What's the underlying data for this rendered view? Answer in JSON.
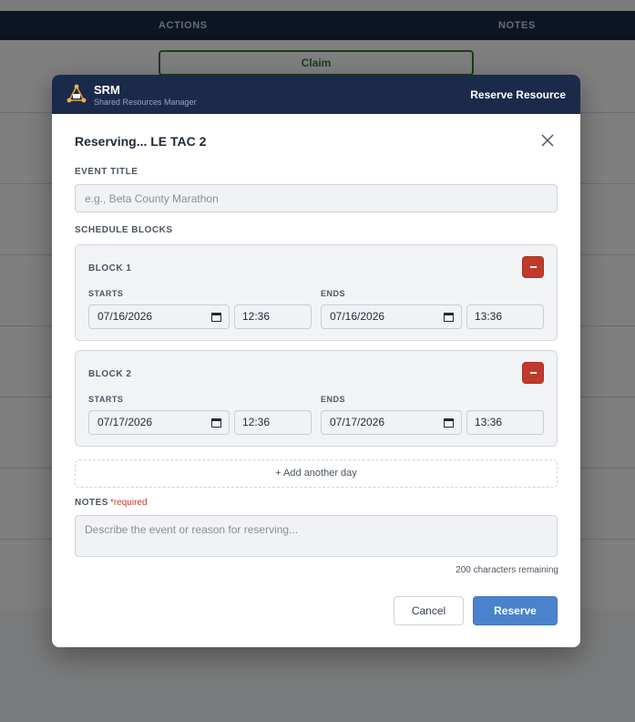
{
  "background": {
    "columns": [
      "ACTIONS",
      "NOTES"
    ],
    "claim_button": "Claim"
  },
  "modal": {
    "brand": {
      "name": "SRM",
      "subtitle": "Shared Resources Manager"
    },
    "header_action": "Reserve Resource",
    "title": "Reserving...  LE TAC 2",
    "event_title": {
      "label": "EVENT TITLE",
      "placeholder": "e.g., Beta County Marathon",
      "value": ""
    },
    "schedule_label": "SCHEDULE BLOCKS",
    "blocks": [
      {
        "title": "BLOCK 1",
        "starts_label": "STARTS",
        "ends_label": "ENDS",
        "start_date": "07/16/2026",
        "start_time": "12:36",
        "end_date": "07/16/2026",
        "end_time": "13:36"
      },
      {
        "title": "BLOCK 2",
        "starts_label": "STARTS",
        "ends_label": "ENDS",
        "start_date": "07/17/2026",
        "start_time": "12:36",
        "end_date": "07/17/2026",
        "end_time": "13:36"
      }
    ],
    "add_day_label": "+  Add another day",
    "notes": {
      "label": "NOTES",
      "required": "*required",
      "placeholder": "Describe the event or reason for reserving...",
      "value": ""
    },
    "char_count": "200 characters remaining",
    "cancel_label": "Cancel",
    "reserve_label": "Reserve"
  },
  "colors": {
    "header_navy": "#1b2a4a",
    "danger": "#c0392b",
    "primary": "#4a82cc",
    "claim_green": "#2e7d32"
  }
}
